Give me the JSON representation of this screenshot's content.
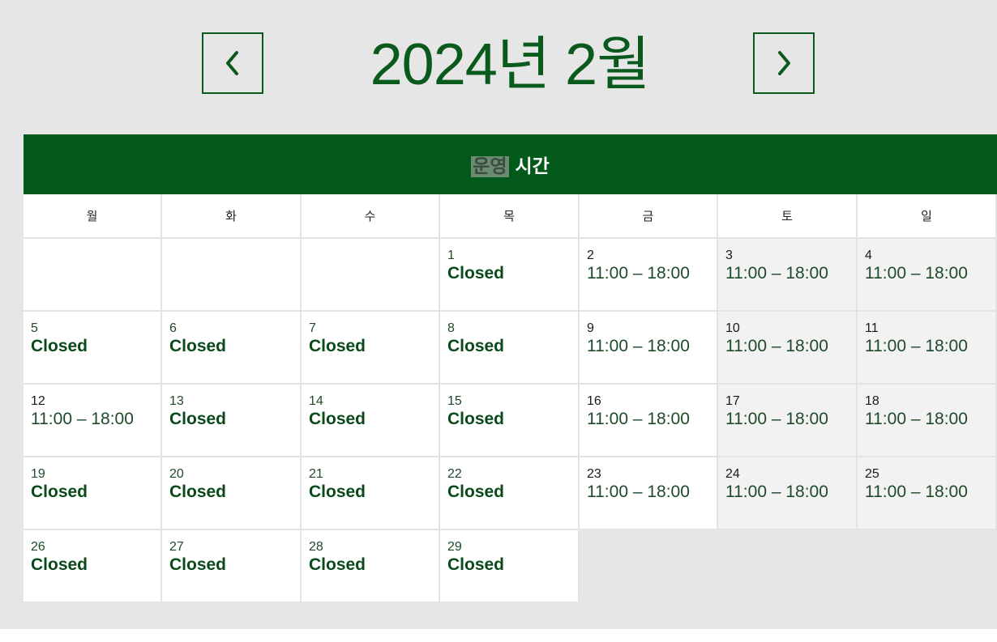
{
  "header": {
    "month_title": "2024년 2월",
    "prev_icon": "chevron-left-icon",
    "next_icon": "chevron-right-icon"
  },
  "band": {
    "title_highlighted": "운영",
    "title_rest": " 시간",
    "accent_color": "#035919"
  },
  "weekdays": [
    "월",
    "화",
    "수",
    "목",
    "금",
    "토",
    "일"
  ],
  "weeks": [
    [
      null,
      null,
      null,
      {
        "day": "1",
        "status": "Closed",
        "closed": true
      },
      {
        "day": "2",
        "status": "11:00 – 18:00",
        "closed": false
      },
      {
        "day": "3",
        "status": "11:00 – 18:00",
        "closed": false
      },
      {
        "day": "4",
        "status": "11:00 – 18:00",
        "closed": false
      }
    ],
    [
      {
        "day": "5",
        "status": "Closed",
        "closed": true
      },
      {
        "day": "6",
        "status": "Closed",
        "closed": true
      },
      {
        "day": "7",
        "status": "Closed",
        "closed": true
      },
      {
        "day": "8",
        "status": "Closed",
        "closed": true
      },
      {
        "day": "9",
        "status": "11:00 – 18:00",
        "closed": false
      },
      {
        "day": "10",
        "status": "11:00 – 18:00",
        "closed": false
      },
      {
        "day": "11",
        "status": "11:00 – 18:00",
        "closed": false
      }
    ],
    [
      {
        "day": "12",
        "status": "11:00 – 18:00",
        "closed": false
      },
      {
        "day": "13",
        "status": "Closed",
        "closed": true
      },
      {
        "day": "14",
        "status": "Closed",
        "closed": true
      },
      {
        "day": "15",
        "status": "Closed",
        "closed": true
      },
      {
        "day": "16",
        "status": "11:00 – 18:00",
        "closed": false
      },
      {
        "day": "17",
        "status": "11:00 – 18:00",
        "closed": false
      },
      {
        "day": "18",
        "status": "11:00 – 18:00",
        "closed": false
      }
    ],
    [
      {
        "day": "19",
        "status": "Closed",
        "closed": true
      },
      {
        "day": "20",
        "status": "Closed",
        "closed": true
      },
      {
        "day": "21",
        "status": "Closed",
        "closed": true
      },
      {
        "day": "22",
        "status": "Closed",
        "closed": true
      },
      {
        "day": "23",
        "status": "11:00 – 18:00",
        "closed": false
      },
      {
        "day": "24",
        "status": "11:00 – 18:00",
        "closed": false
      },
      {
        "day": "25",
        "status": "11:00 – 18:00",
        "closed": false
      }
    ],
    [
      {
        "day": "26",
        "status": "Closed",
        "closed": true
      },
      {
        "day": "27",
        "status": "Closed",
        "closed": true
      },
      {
        "day": "28",
        "status": "Closed",
        "closed": true
      },
      {
        "day": "29",
        "status": "Closed",
        "closed": true
      },
      null,
      null,
      null
    ]
  ]
}
